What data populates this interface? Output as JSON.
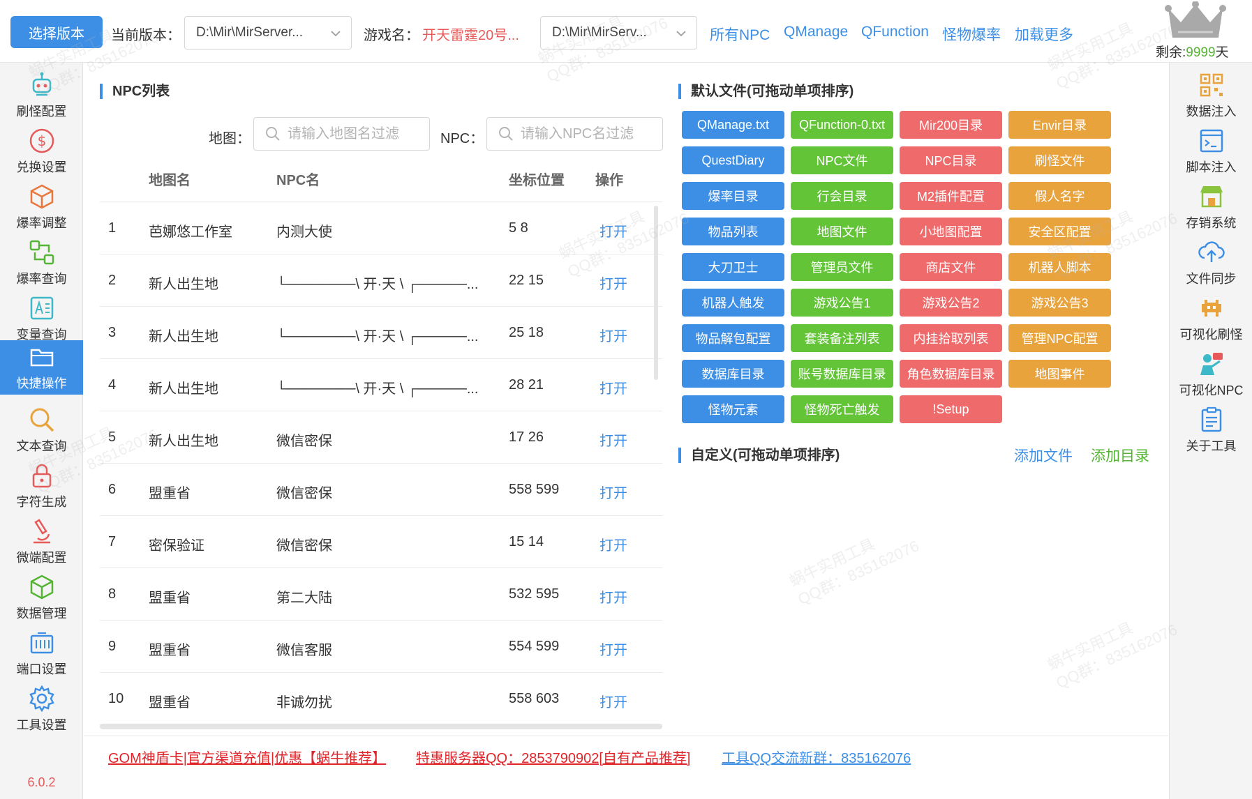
{
  "topbar": {
    "select_version_label": "选择版本",
    "current_version_label": "当前版本：",
    "current_version_value": "D:\\Mir\\MirServer...",
    "game_name_label": "游戏名：",
    "game_name_value": "开天雷霆20号...",
    "path_value": "D:\\Mir\\MirServ...",
    "links": [
      "所有NPC",
      "QManage",
      "QFunction",
      "怪物爆率",
      "加载更多"
    ],
    "remain_label": "剩余:",
    "remain_value": "9999",
    "remain_unit": "天"
  },
  "sidebar": {
    "items": [
      {
        "label": "刷怪配置",
        "icon": "robot-icon"
      },
      {
        "label": "兑换设置",
        "icon": "dollar-icon"
      },
      {
        "label": "爆率调整",
        "icon": "cube-icon"
      },
      {
        "label": "爆率查询",
        "icon": "flow-icon"
      },
      {
        "label": "变量查询",
        "icon": "text-icon"
      },
      {
        "label": "快捷操作",
        "icon": "folder-icon"
      },
      {
        "label": "文本查询",
        "icon": "magnifier-icon"
      },
      {
        "label": "字符生成",
        "icon": "lock-icon"
      },
      {
        "label": "微端配置",
        "icon": "microscope-icon"
      },
      {
        "label": "数据管理",
        "icon": "box-icon"
      },
      {
        "label": "端口设置",
        "icon": "port-icon"
      },
      {
        "label": "工具设置",
        "icon": "gear-icon"
      }
    ],
    "version": "6.0.2"
  },
  "right_sidebar": {
    "items": [
      {
        "label": "数据注入",
        "icon": "qrcode-icon"
      },
      {
        "label": "脚本注入",
        "icon": "terminal-icon"
      },
      {
        "label": "存销系统",
        "icon": "shop-icon"
      },
      {
        "label": "文件同步",
        "icon": "cloud-icon"
      },
      {
        "label": "可视化刷怪",
        "icon": "invader-icon"
      },
      {
        "label": "可视化NPC",
        "icon": "npc-icon"
      },
      {
        "label": "关于工具",
        "icon": "clipboard-icon"
      }
    ]
  },
  "npc_panel": {
    "title": "NPC列表",
    "map_label": "地图：",
    "map_placeholder": "请输入地图名过滤",
    "npc_label": "NPC：",
    "npc_placeholder": "请输入NPC名过滤",
    "headers": [
      "地图名",
      "NPC名",
      "坐标位置",
      "操作"
    ],
    "rows": [
      {
        "idx": "1",
        "map": "芭娜悠工作室",
        "npc": "内测大使",
        "pos": "5 8",
        "op": "打开"
      },
      {
        "idx": "2",
        "map": "新人出生地",
        "npc": "└───────\\ 开·天 \\ ┌─────...",
        "pos": "22 15",
        "op": "打开"
      },
      {
        "idx": "3",
        "map": "新人出生地",
        "npc": "└───────\\ 开·天 \\ ┌─────...",
        "pos": "25 18",
        "op": "打开"
      },
      {
        "idx": "4",
        "map": "新人出生地",
        "npc": "└───────\\ 开·天 \\ ┌─────...",
        "pos": "28 21",
        "op": "打开"
      },
      {
        "idx": "5",
        "map": "新人出生地",
        "npc": "微信密保",
        "pos": "17 26",
        "op": "打开"
      },
      {
        "idx": "6",
        "map": "盟重省",
        "npc": "微信密保",
        "pos": "558 599",
        "op": "打开"
      },
      {
        "idx": "7",
        "map": "密保验证",
        "npc": "微信密保",
        "pos": "15 14",
        "op": "打开"
      },
      {
        "idx": "8",
        "map": "盟重省",
        "npc": "第二大陆",
        "pos": "532 595",
        "op": "打开"
      },
      {
        "idx": "9",
        "map": "盟重省",
        "npc": "微信客服",
        "pos": "554 599",
        "op": "打开"
      },
      {
        "idx": "10",
        "map": "盟重省",
        "npc": "非诚勿扰",
        "pos": "558 603",
        "op": "打开"
      }
    ]
  },
  "files_panel": {
    "title": "默认文件(可拖动单项排序)",
    "buttons": [
      {
        "label": "QManage.txt",
        "color": "#3d8fe6"
      },
      {
        "label": "QFunction-0.txt",
        "color": "#63c438"
      },
      {
        "label": "Mir200目录",
        "color": "#ef6b6b"
      },
      {
        "label": "Envir目录",
        "color": "#e8a33d"
      },
      {
        "label": "QuestDiary",
        "color": "#3d8fe6"
      },
      {
        "label": "NPC文件",
        "color": "#63c438"
      },
      {
        "label": "NPC目录",
        "color": "#ef6b6b"
      },
      {
        "label": "刷怪文件",
        "color": "#e8a33d"
      },
      {
        "label": "爆率目录",
        "color": "#3d8fe6"
      },
      {
        "label": "行会目录",
        "color": "#63c438"
      },
      {
        "label": "M2插件配置",
        "color": "#ef6b6b"
      },
      {
        "label": "假人名字",
        "color": "#e8a33d"
      },
      {
        "label": "物品列表",
        "color": "#3d8fe6"
      },
      {
        "label": "地图文件",
        "color": "#63c438"
      },
      {
        "label": "小地图配置",
        "color": "#ef6b6b"
      },
      {
        "label": "安全区配置",
        "color": "#e8a33d"
      },
      {
        "label": "大刀卫士",
        "color": "#3d8fe6"
      },
      {
        "label": "管理员文件",
        "color": "#63c438"
      },
      {
        "label": "商店文件",
        "color": "#ef6b6b"
      },
      {
        "label": "机器人脚本",
        "color": "#e8a33d"
      },
      {
        "label": "机器人触发",
        "color": "#3d8fe6"
      },
      {
        "label": "游戏公告1",
        "color": "#63c438"
      },
      {
        "label": "游戏公告2",
        "color": "#ef6b6b"
      },
      {
        "label": "游戏公告3",
        "color": "#e8a33d"
      },
      {
        "label": "物品解包配置",
        "color": "#3d8fe6"
      },
      {
        "label": "套装备注列表",
        "color": "#63c438"
      },
      {
        "label": "内挂拾取列表",
        "color": "#ef6b6b"
      },
      {
        "label": "管理NPC配置",
        "color": "#e8a33d"
      },
      {
        "label": "数据库目录",
        "color": "#3d8fe6"
      },
      {
        "label": "账号数据库目录",
        "color": "#63c438"
      },
      {
        "label": "角色数据库目录",
        "color": "#ef6b6b"
      },
      {
        "label": "地图事件",
        "color": "#e8a33d"
      },
      {
        "label": "怪物元素",
        "color": "#3d8fe6"
      },
      {
        "label": "怪物死亡触发",
        "color": "#63c438"
      },
      {
        "label": "!Setup",
        "color": "#ef6b6b"
      }
    ],
    "custom_title": "自定义(可拖动单项排序)",
    "add_file": "添加文件",
    "add_dir": "添加目录"
  },
  "bottom": {
    "link1": "GOM神盾卡|官方渠道充值|优惠【蜗牛推荐】",
    "link2": "特惠服务器QQ：2853790902[自有产品推荐]",
    "link3": "工具QQ交流新群：835162076"
  },
  "watermark": {
    "line1": "蜗牛实用工具",
    "line2": "QQ群：835162076"
  },
  "colors": {
    "accent": "#3d8fe6",
    "green": "#63c438",
    "red": "#ef6b6b",
    "orange": "#e8a33d"
  }
}
